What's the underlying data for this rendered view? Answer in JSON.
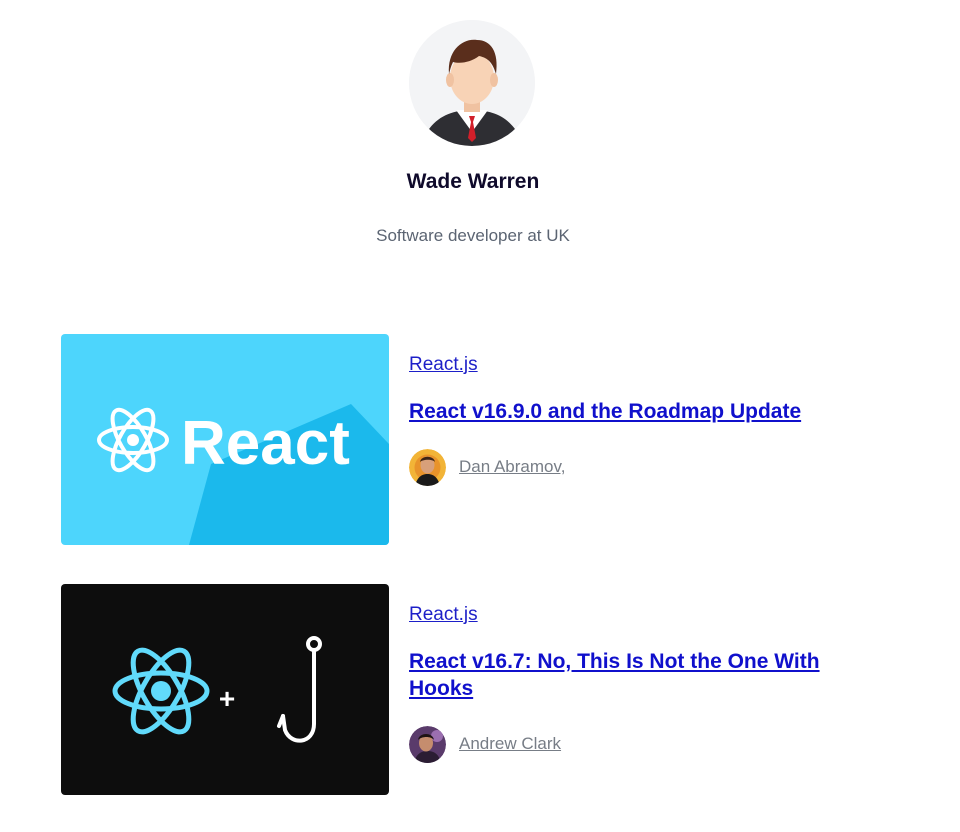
{
  "profile": {
    "name": "Wade Warren",
    "bio": "Software developer at UK",
    "avatar_icon": "user-avatar-icon"
  },
  "posts": [
    {
      "category": "React.js",
      "title": "React v16.9.0 and the Roadmap Update",
      "author": "Dan Abramov,",
      "thumbnail_text": "React",
      "thumbnail_bg": "#4dd5fc"
    },
    {
      "category": "React.js",
      "title": "React v16.7: No, This Is Not the One With Hooks",
      "author": "Andrew Clark",
      "thumbnail_bg": "#0d0d0d"
    }
  ],
  "colors": {
    "link": "#1010cc",
    "muted_text": "#777d86",
    "react_cyan": "#61dafb"
  }
}
